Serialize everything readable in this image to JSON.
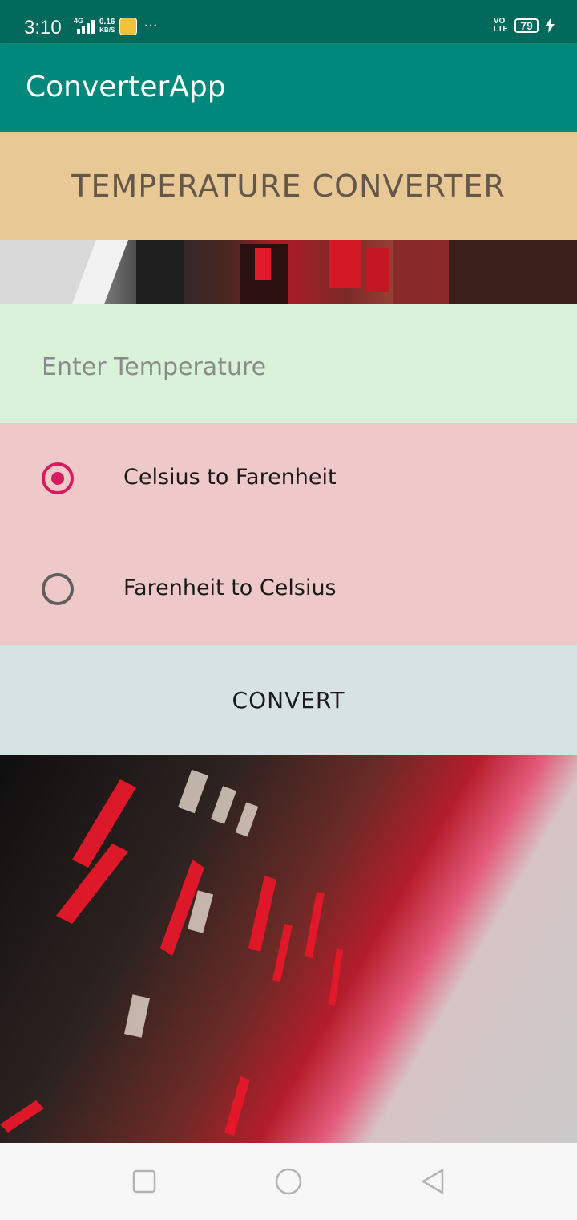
{
  "status_bar": {
    "time": "3:10",
    "network_label": "4G",
    "speed_value": "0.16",
    "speed_unit": "KB/S",
    "overflow": "···",
    "volte_line1": "VO",
    "volte_line2": "LTE",
    "battery": "79"
  },
  "app_bar": {
    "title": "ConverterApp"
  },
  "header": {
    "title": "TEMPERATURE CONVERTER"
  },
  "input": {
    "placeholder": "Enter Temperature",
    "value": ""
  },
  "radio_options": [
    {
      "label": "Celsius to Farenheit",
      "checked": true
    },
    {
      "label": "Farenheit to Celsius",
      "checked": false
    }
  ],
  "convert_button": {
    "label": "CONVERT"
  },
  "colors": {
    "status_bar": "#00695c",
    "app_bar": "#00897b",
    "header_bg": "#e8c995",
    "input_bg": "#d9f2d9",
    "radio_bg": "#efc9c9",
    "button_bg": "#d7e2e3",
    "accent": "#d81b60"
  },
  "nav_bar": {
    "icons": [
      "recent-apps-icon",
      "home-icon",
      "back-icon"
    ]
  }
}
